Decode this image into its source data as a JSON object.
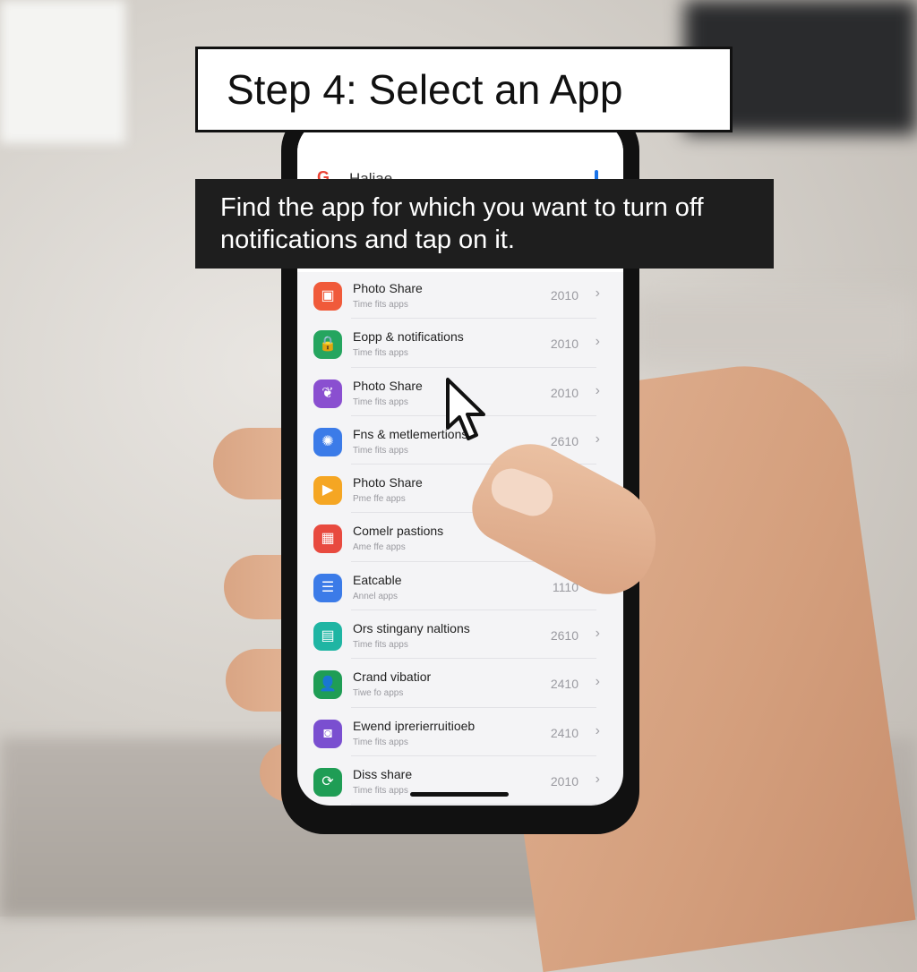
{
  "overlay": {
    "step_title": "Step 4: Select an App",
    "caption": "Find the app for which you want to turn off notifications and tap on it."
  },
  "screen_header": {
    "title": "Haliae"
  },
  "apps": [
    {
      "name": "Photo Share",
      "sub": "Time fits apps",
      "count": "2010",
      "color": "#f05a3a",
      "icon": "camera-icon",
      "glyph": "▣"
    },
    {
      "name": "Eopp & notifications",
      "sub": "Time fits apps",
      "count": "2010",
      "color": "#25a55f",
      "icon": "lock-icon",
      "glyph": "🔒"
    },
    {
      "name": "Photo Share",
      "sub": "Time fits apps",
      "count": "2010",
      "color": "#8a4fd0",
      "icon": "leaf-icon",
      "glyph": "❦"
    },
    {
      "name": "Fns & metlemertions",
      "sub": "Time fits apps",
      "count": "2610",
      "color": "#3b7be8",
      "icon": "dial-icon",
      "glyph": "✺"
    },
    {
      "name": "Photo Share",
      "sub": "Pme ffe apps",
      "count": "",
      "color": "#f5a623",
      "icon": "play-icon",
      "glyph": "▶"
    },
    {
      "name": "Comelr pastions",
      "sub": "Ame ffe apps",
      "count": "",
      "color": "#e84a3f",
      "icon": "grid-icon",
      "glyph": "▦"
    },
    {
      "name": "Eatcable",
      "sub": "Annel apps",
      "count": "1110",
      "color": "#3b7be8",
      "icon": "chat-icon",
      "glyph": "☰"
    },
    {
      "name": "Ors stingany naltions",
      "sub": "Time fits apps",
      "count": "2610",
      "color": "#1fb5a3",
      "icon": "message-icon",
      "glyph": "▤"
    },
    {
      "name": "Crand vibatior",
      "sub": "Tiwe fo apps",
      "count": "2410",
      "color": "#1f9d55",
      "icon": "person-icon",
      "glyph": "👤"
    },
    {
      "name": "Ewend iprerierruitioeb",
      "sub": "Time fits apps",
      "count": "2410",
      "color": "#7a4fd0",
      "icon": "video-icon",
      "glyph": "◙"
    },
    {
      "name": "Diss share",
      "sub": "Time fits apps",
      "count": "2010",
      "color": "#1f9d55",
      "icon": "share-icon",
      "glyph": "⟳"
    }
  ]
}
